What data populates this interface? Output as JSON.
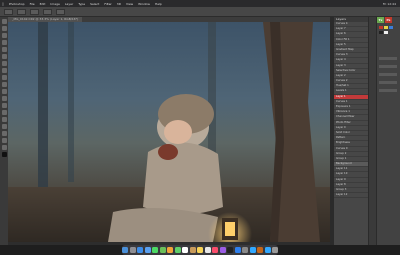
{
  "menubar": {
    "items": [
      "Photoshop",
      "File",
      "Edit",
      "Image",
      "Layer",
      "Type",
      "Select",
      "Filter",
      "3D",
      "View",
      "Window",
      "Help"
    ],
    "status_text": "Fri 12:44"
  },
  "doc_tab": {
    "label": "_MG_0142.CR2 @ 33.3% (Layer 1, RGB/16*)"
  },
  "layers_panel": {
    "header": "Layers",
    "rows": [
      "Curves 4",
      "Layer 7",
      "Layer 6",
      "Color Fill 1",
      "Layer 5",
      "Gradient Map",
      "Curves 3",
      "Layer 4",
      "Layer 3",
      "Selective Color",
      "Layer 2",
      "Curves 2",
      "Hue/Sat 1",
      "Levels 1",
      "Layer 1",
      "Curves 1",
      "Exposure 1",
      "Vibrance 1",
      "Channel Mixer",
      "Photo Filter",
      "Layer 0",
      "Solid Color",
      "Pattern",
      "Brightness",
      "Curves 0",
      "Group 2",
      "Group 1",
      "Background",
      "Layer 11",
      "Layer 10",
      "Layer 9",
      "Layer 8",
      "Group 3",
      "Layer 12"
    ],
    "active_index": 14,
    "selected_index": 27
  },
  "props_panel": {
    "ps_chip": "Ps",
    "ps_chip_color": "#c0392b",
    "ps_chip2": "Tx",
    "ps_chip2_color": "#6aa84f"
  },
  "colors": {
    "accent": "#c23a3a"
  },
  "dock": {
    "apps": [
      "finder",
      "launchpad",
      "safari",
      "mail",
      "messages",
      "maps",
      "photos",
      "facetime",
      "calendar",
      "contacts",
      "notes",
      "reminders",
      "music",
      "podcasts",
      "tv",
      "app-store",
      "settings",
      "photoshop",
      "bridge",
      "lightroom",
      "trash"
    ]
  }
}
